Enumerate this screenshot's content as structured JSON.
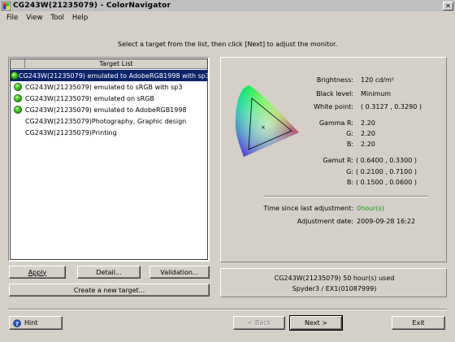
{
  "window": {
    "title": "CG243W(21235079) - ColorNavigator",
    "icon": "colornavigator-app-icon"
  },
  "menu": [
    "File",
    "View",
    "Tool",
    "Help"
  ],
  "instruction": "Select a target from the list, then click [Next] to adjust the monitor.",
  "target_list": {
    "header": "Target List",
    "selected_index": 0,
    "items": [
      {
        "label": "CG243W(21235079) emulated to AdobeRGB1998 with sp3",
        "has_status_icon": true
      },
      {
        "label": "CG243W(21235079) emulated to sRGB with sp3",
        "has_status_icon": true
      },
      {
        "label": "CG243W(21235079) emulated on sRGB",
        "has_status_icon": true
      },
      {
        "label": "CG243W(21235079) emulated to AdobeRGB1998",
        "has_status_icon": true
      },
      {
        "label": "CG243W(21235079)Photography, Graphic design",
        "has_status_icon": false
      },
      {
        "label": "CG243W(21235079)Printing",
        "has_status_icon": false
      }
    ]
  },
  "buttons": {
    "apply": "Apply",
    "detail": "Detail...",
    "validation": "Validation...",
    "create": "Create a new target...",
    "hint": "Hint",
    "back": "< Back",
    "next": "Next >",
    "exit": "Exit"
  },
  "info": {
    "brightness_label": "Brightness:",
    "brightness": "120 cd/m²",
    "black_level_label": "Black level:",
    "black_level": "Minimum",
    "white_point_label": "White point:",
    "white_point": "( 0.3127 , 0.3290 )",
    "gamma_r_label": "Gamma R:",
    "gamma_r": "2.20",
    "gamma_g_label": "G:",
    "gamma_g": "2.20",
    "gamma_b_label": "B:",
    "gamma_b": "2.20",
    "gamut_r_label": "Gamut R:",
    "gamut_r": "( 0.6400 , 0.3300 )",
    "gamut_g_label": "G:",
    "gamut_g": "( 0.2100 , 0.7100 )",
    "gamut_b_label": "B:",
    "gamut_b": "( 0.1500 , 0.0600 )",
    "time_label": "Time since last adjustment:",
    "time": "0hour(s)",
    "date_label": "Adjustment date:",
    "date": "2009-09-28 16:22"
  },
  "monitor": {
    "usage": "CG243W(21235079) 50 hour(s) used",
    "sensor": "Spyder3 / EX1(01087999)"
  },
  "colors": {
    "selection": "#0a246a",
    "status_green": "#1a9a1a",
    "face": "#d4d0c8"
  }
}
